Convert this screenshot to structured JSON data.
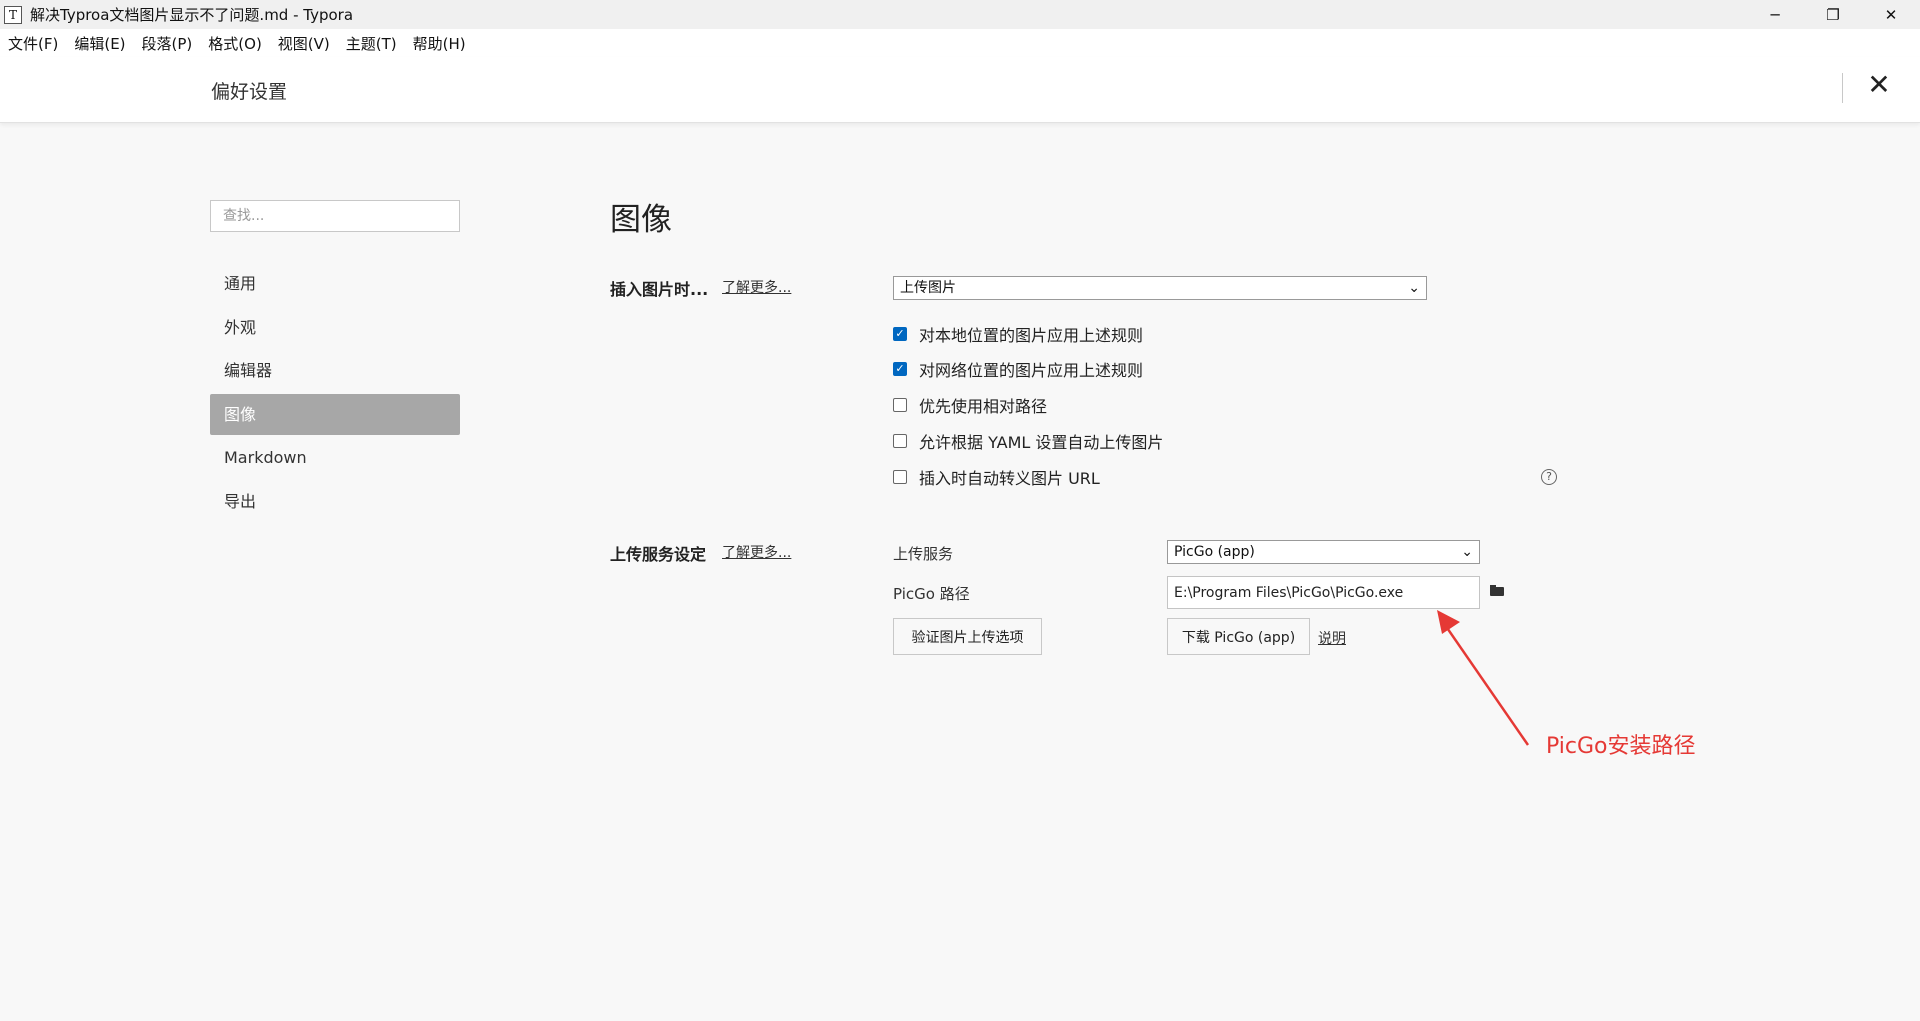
{
  "window": {
    "app_icon_glyph": "T",
    "title": "解决Typroa文档图片显示不了问题.md - Typora",
    "minimize_glyph": "─",
    "restore_glyph": "❐",
    "close_glyph": "✕"
  },
  "menubar": {
    "items": [
      "文件(F)",
      "编辑(E)",
      "段落(P)",
      "格式(O)",
      "视图(V)",
      "主题(T)",
      "帮助(H)"
    ]
  },
  "preferences": {
    "title": "偏好设置",
    "close_glyph": "✕",
    "search": {
      "placeholder": "查找...",
      "value": ""
    },
    "nav": {
      "items": [
        "通用",
        "外观",
        "编辑器",
        "图像",
        "Markdown",
        "导出"
      ],
      "active": "图像"
    }
  },
  "image_section": {
    "title": "图像",
    "insert": {
      "label": "插入图片时...",
      "learn_more": "了解更多...",
      "select_value": "上传图片",
      "options": [
        {
          "label": "对本地位置的图片应用上述规则",
          "checked": true
        },
        {
          "label": "对网络位置的图片应用上述规则",
          "checked": true
        },
        {
          "label": "优先使用相对路径",
          "checked": false
        },
        {
          "label": "允许根据 YAML 设置自动上传图片",
          "checked": false
        },
        {
          "label": "插入时自动转义图片 URL",
          "checked": false
        }
      ],
      "help_glyph": "?"
    },
    "upload": {
      "label": "上传服务设定",
      "learn_more": "了解更多...",
      "service_label": "上传服务",
      "service_value": "PicGo (app)",
      "path_label": "PicGo 路径",
      "path_value": "E:\\Program Files\\PicGo\\PicGo.exe",
      "verify_button": "验证图片上传选项",
      "download_button": "下载 PicGo (app)",
      "explain_link": "说明"
    }
  },
  "annotation": {
    "text": "PicGo安装路径",
    "color": "#e53935"
  },
  "icons": {
    "dropdown": "chevron-down-icon",
    "folder": "folder-icon",
    "help": "help-icon"
  }
}
